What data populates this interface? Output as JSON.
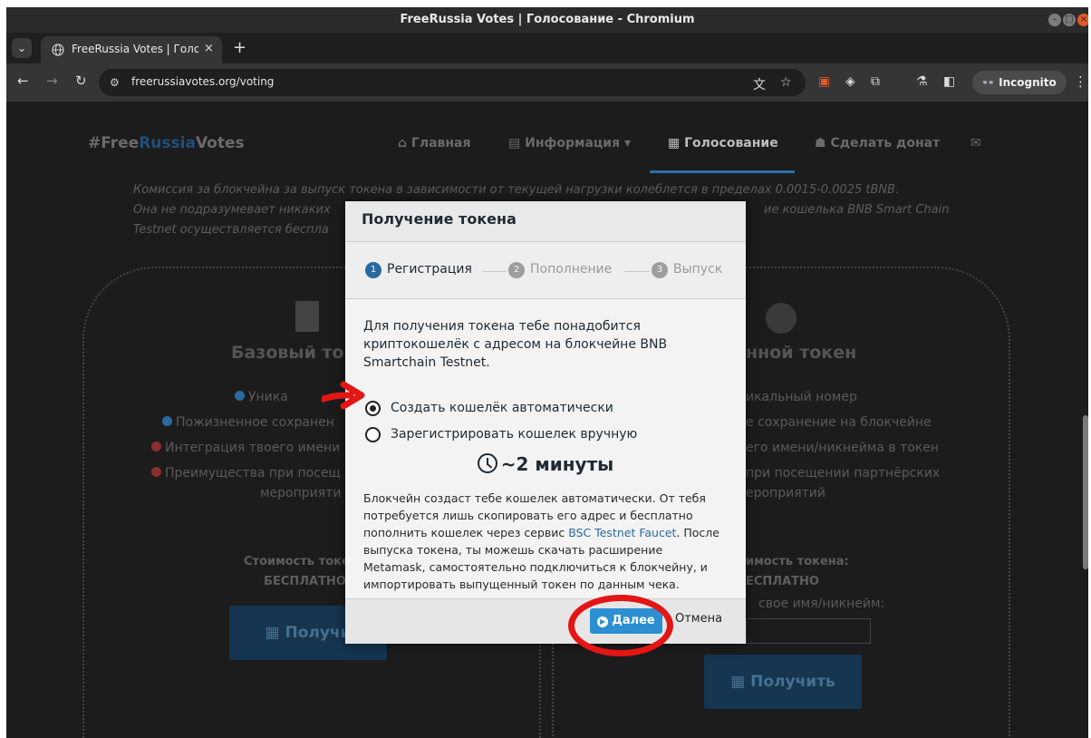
{
  "window": {
    "title": "FreeRussia Votes | Голосование - Chromium"
  },
  "tab": {
    "title": "FreeRussia Votes | Голо",
    "close": "×",
    "new": "+"
  },
  "toolbar": {
    "url": "freerussiavotes.org/voting",
    "incognito": "Incognito"
  },
  "site": {
    "brand_prefix": "#Free",
    "brand_blue": "Russia",
    "brand_suffix": "Votes",
    "nav": [
      "Главная",
      "Информация",
      "Голосование",
      "Сделать донат"
    ],
    "top_ghost_1": "",
    "top_ghost_2": "",
    "commission_1": "Комиссия за блокчейна за выпуск токена в зависимости от текущей нагрузки колеблется в пределах 0.0015-0.0025 tBNB.",
    "commission_2a": "Она не подразумевает никаких",
    "commission_2b": "ие кошелька BNB Smart Chain",
    "commission_3": "Testnet осуществляется беспла",
    "basic": {
      "title": "Базовый то",
      "features": [
        "Уника",
        "Пожизненное сохранен",
        "Интеграция твоего имени",
        "Преимущества при посещ"
      ],
      "feature_tail": "мероприяти",
      "price_label": "Стоимость токе",
      "price_value": "БЕСПЛАТНО",
      "button": "Получи"
    },
    "named": {
      "title": "нной токен",
      "features": [
        "икальный номер",
        "е сохранение на блокчейне",
        "его имени/никнейма в токен",
        "при посещении партнёрских"
      ],
      "feature_tail": "ероприятий",
      "price_label": "имость токена:",
      "price_value": "ЕСПЛАТНО",
      "name_label": "свое имя/никнейм:",
      "button": "Получить"
    }
  },
  "modal": {
    "title": "Получение токена",
    "steps": [
      {
        "num": "1",
        "label": "Регистрация",
        "active": true
      },
      {
        "num": "2",
        "label": "Пополнение",
        "active": false
      },
      {
        "num": "3",
        "label": "Выпуск",
        "active": false
      }
    ],
    "intro": "Для получения токена тебе понадобится криптокошелёк с адресом на блокчейне BNB Smartchain Testnet.",
    "options": [
      {
        "label": "Создать кошелёк автоматически",
        "selected": true
      },
      {
        "label": "Зарегистрировать кошелек вручную",
        "selected": false
      }
    ],
    "timer": "~2 минуты",
    "desc_before": "Блокчейн создаст тебе кошелек автоматически. От тебя потребуется лишь скопировать его адрес и бесплатно пополнить кошелек через сервис ",
    "desc_link": "BSC Testnet Faucet",
    "desc_after": ". После выпуска токена, ты можешь скачать расширение Metamask, самостоятельно подключиться к блокчейну, и импортировать выпущенный токен по данным чека.",
    "next": "Далее",
    "cancel": "Отмена"
  },
  "colors": {
    "accent": "#2b8fd1",
    "annotation": "#e41515",
    "active_step": "#2b6aa1"
  }
}
